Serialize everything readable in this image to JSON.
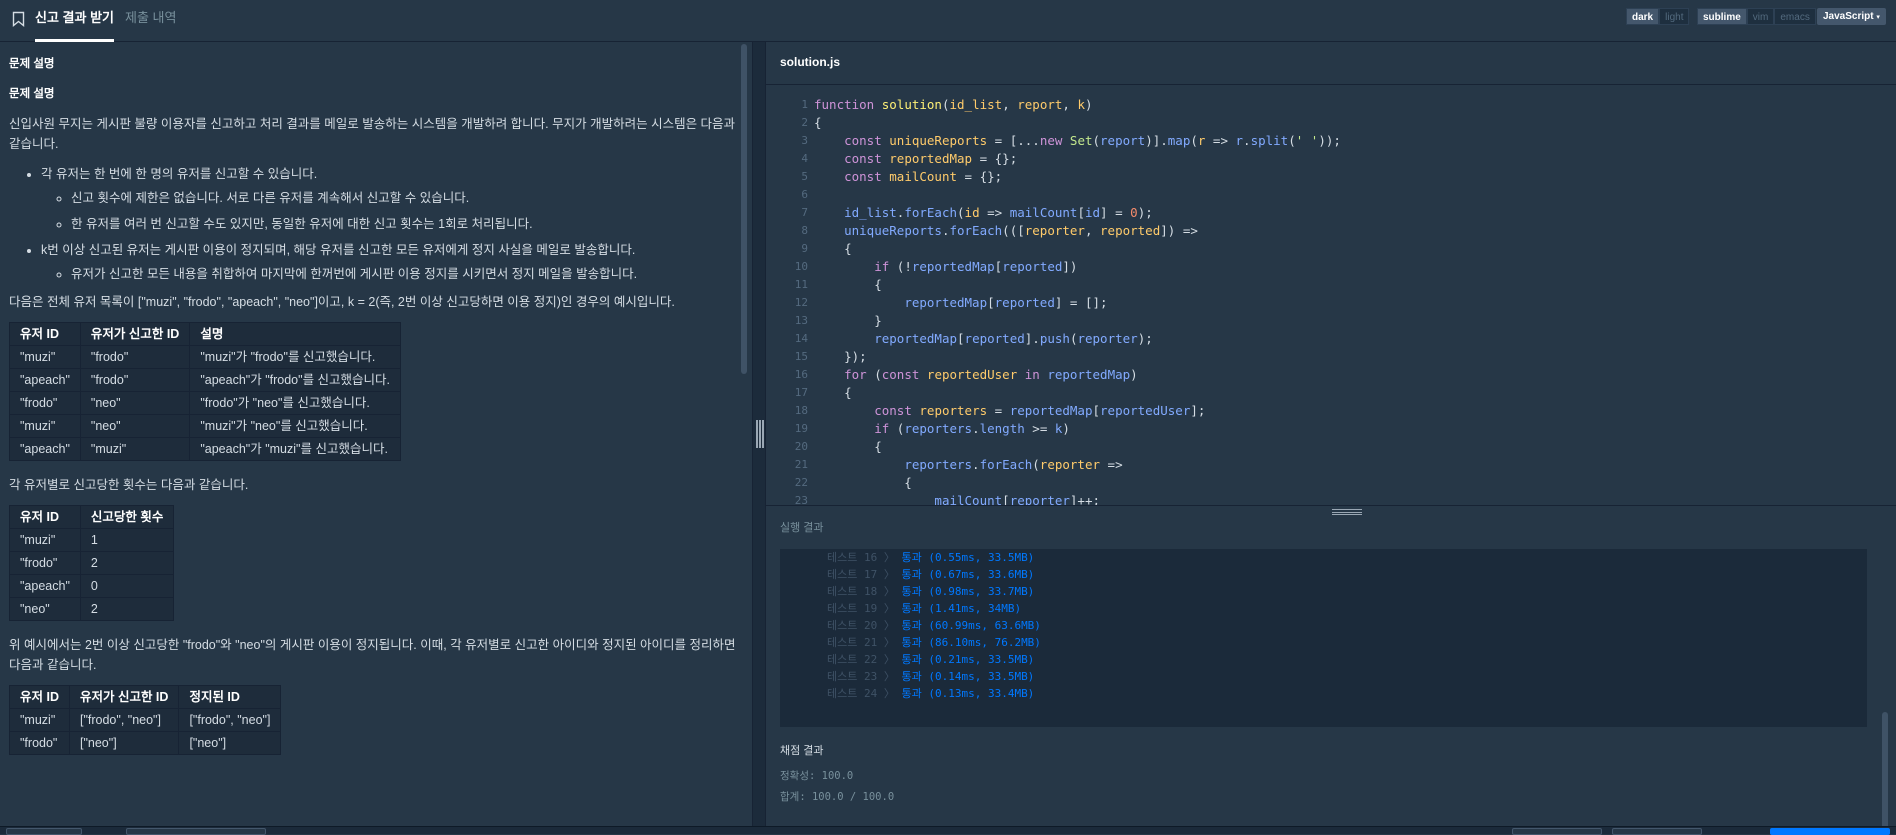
{
  "nav": {
    "tab_active": "신고 결과 받기",
    "tab_inactive": "제출 내역",
    "theme_dark": "dark",
    "theme_light": "light",
    "keymap_sublime": "sublime",
    "keymap_vim": "vim",
    "keymap_emacs": "emacs",
    "language": "JavaScript"
  },
  "problem": {
    "section_title": "문제 설명",
    "subtitle": "문제 설명",
    "intro": "신입사원 무지는 게시판 불량 이용자를 신고하고 처리 결과를 메일로 발송하는 시스템을 개발하려 합니다. 무지가 개발하려는 시스템은 다음과 같습니다.",
    "rule1": "각 유저는 한 번에 한 명의 유저를 신고할 수 있습니다.",
    "rule1a": "신고 횟수에 제한은 없습니다. 서로 다른 유저를 계속해서 신고할 수 있습니다.",
    "rule1b": "한 유저를 여러 번 신고할 수도 있지만, 동일한 유저에 대한 신고 횟수는 1회로 처리됩니다.",
    "rule2": "k번 이상 신고된 유저는 게시판 이용이 정지되며, 해당 유저를 신고한 모든 유저에게 정지 사실을 메일로 발송합니다.",
    "rule2a": "유저가 신고한 모든 내용을 취합하여 마지막에 한꺼번에 게시판 이용 정지를 시키면서 정지 메일을 발송합니다.",
    "example_intro": "다음은 전체 유저 목록이 [\"muzi\", \"frodo\", \"apeach\", \"neo\"]이고, k = 2(즉, 2번 이상 신고당하면 이용 정지)인 경우의 예시입니다.",
    "table1": {
      "headers": [
        "유저 ID",
        "유저가 신고한 ID",
        "설명"
      ],
      "rows": [
        [
          "\"muzi\"",
          "\"frodo\"",
          "\"muzi\"가 \"frodo\"를 신고했습니다."
        ],
        [
          "\"apeach\"",
          "\"frodo\"",
          "\"apeach\"가 \"frodo\"를 신고했습니다."
        ],
        [
          "\"frodo\"",
          "\"neo\"",
          "\"frodo\"가 \"neo\"를 신고했습니다."
        ],
        [
          "\"muzi\"",
          "\"neo\"",
          "\"muzi\"가 \"neo\"를 신고했습니다."
        ],
        [
          "\"apeach\"",
          "\"muzi\"",
          "\"apeach\"가 \"muzi\"를 신고했습니다."
        ]
      ]
    },
    "count_intro": "각 유저별로 신고당한 횟수는 다음과 같습니다.",
    "table2": {
      "headers": [
        "유저 ID",
        "신고당한 횟수"
      ],
      "rows": [
        [
          "\"muzi\"",
          "1"
        ],
        [
          "\"frodo\"",
          "2"
        ],
        [
          "\"apeach\"",
          "0"
        ],
        [
          "\"neo\"",
          "2"
        ]
      ]
    },
    "suspend_intro": "위 예시에서는 2번 이상 신고당한 \"frodo\"와 \"neo\"의 게시판 이용이 정지됩니다. 이때, 각 유저별로 신고한 아이디와 정지된 아이디를 정리하면 다음과 같습니다.",
    "table3": {
      "headers": [
        "유저 ID",
        "유저가 신고한 ID",
        "정지된 ID"
      ],
      "rows": [
        [
          "\"muzi\"",
          "[\"frodo\", \"neo\"]",
          "[\"frodo\", \"neo\"]"
        ],
        [
          "\"frodo\"",
          "[\"neo\"]",
          "[\"neo\"]"
        ]
      ]
    }
  },
  "editor": {
    "filename": "solution.js",
    "line_numbers": [
      "1",
      "2",
      "3",
      "4",
      "5",
      "6",
      "7",
      "8",
      "9",
      "10",
      "11",
      "12",
      "13",
      "14",
      "15",
      "16",
      "17",
      "18",
      "19",
      "20",
      "21",
      "22",
      "23"
    ]
  },
  "results": {
    "title": "실행 결과",
    "tests": [
      {
        "label": "테스트 16 〉",
        "result": "통과 (0.55ms, 33.5MB)"
      },
      {
        "label": "테스트 17 〉",
        "result": "통과 (0.67ms, 33.6MB)"
      },
      {
        "label": "테스트 18 〉",
        "result": "통과 (0.98ms, 33.7MB)"
      },
      {
        "label": "테스트 19 〉",
        "result": "통과 (1.41ms, 34MB)"
      },
      {
        "label": "테스트 20 〉",
        "result": "통과 (60.99ms, 63.6MB)"
      },
      {
        "label": "테스트 21 〉",
        "result": "통과 (86.10ms, 76.2MB)"
      },
      {
        "label": "테스트 22 〉",
        "result": "통과 (0.21ms, 33.5MB)"
      },
      {
        "label": "테스트 23 〉",
        "result": "통과 (0.14ms, 33.5MB)"
      },
      {
        "label": "테스트 24 〉",
        "result": "통과 (0.13ms, 33.4MB)"
      }
    ],
    "grading_title": "채점 결과",
    "accuracy": "정확성: 100.0",
    "total": "합계: 100.0 / 100.0"
  }
}
